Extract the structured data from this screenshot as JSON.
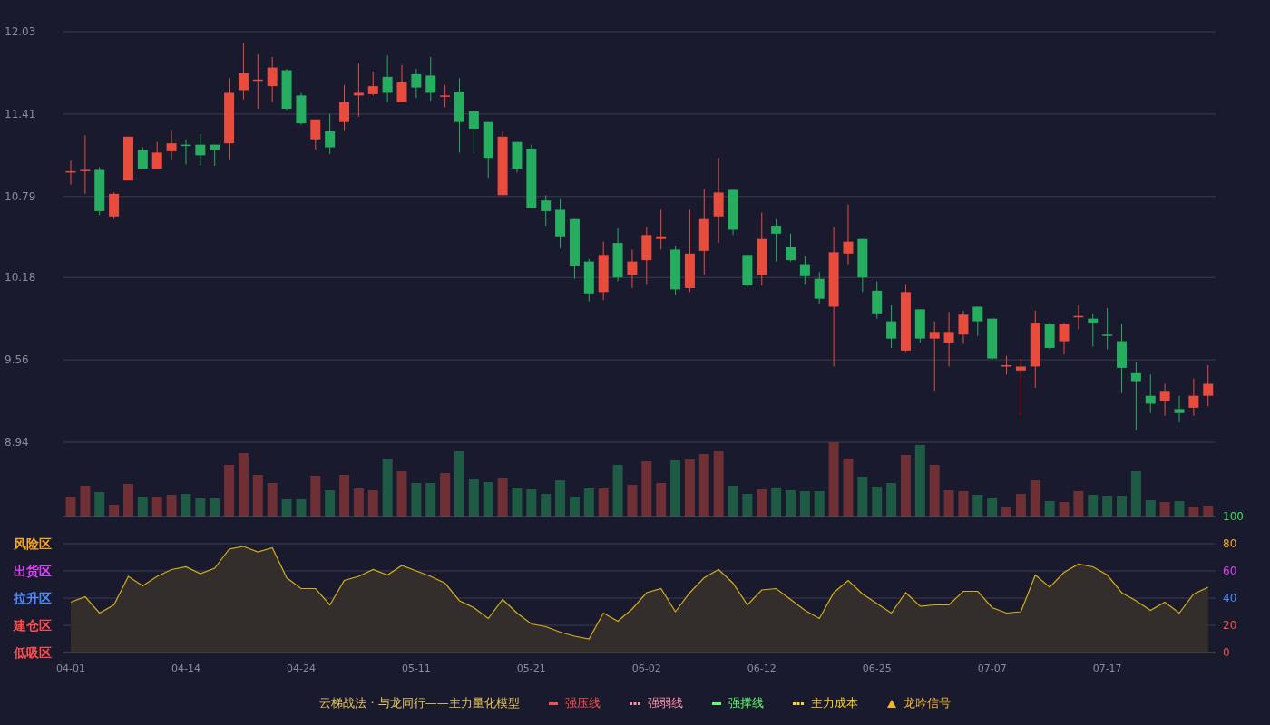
{
  "price_chart": {
    "chart_data": {
      "type": "candlestick",
      "grid": true,
      "ylim": [
        8.94,
        12.03
      ],
      "yticks": [
        {
          "value": 12.03,
          "label": "12.03"
        },
        {
          "value": 11.41,
          "label": "11.41"
        },
        {
          "value": 10.79,
          "label": "10.79"
        },
        {
          "value": 10.18,
          "label": "10.18"
        },
        {
          "value": 9.56,
          "label": "9.56"
        },
        {
          "value": 8.94,
          "label": "8.94"
        }
      ],
      "categories": [
        null,
        null,
        null,
        null,
        null,
        null,
        null,
        null,
        null,
        null,
        null,
        null,
        null,
        null,
        null,
        null,
        null,
        null,
        null,
        null,
        null,
        null,
        null,
        null,
        null,
        null,
        null,
        null,
        null,
        null,
        null,
        null,
        null,
        null,
        null,
        null,
        null,
        null,
        null,
        null,
        null,
        null,
        null,
        null,
        null,
        null,
        null,
        null,
        null,
        null,
        null,
        null,
        null,
        null,
        null,
        null,
        null,
        null,
        null,
        null,
        null,
        null,
        null,
        null,
        null,
        null,
        null,
        null,
        null,
        null,
        null,
        null,
        null,
        null,
        null,
        null,
        null,
        null,
        null,
        null
      ],
      "ohlc": [
        [
          10.97,
          11.06,
          10.88,
          10.98
        ],
        [
          10.98,
          11.25,
          10.81,
          10.99
        ],
        [
          10.99,
          11.01,
          10.65,
          10.68
        ],
        [
          10.64,
          10.82,
          10.62,
          10.81
        ],
        [
          10.91,
          11.24,
          10.91,
          11.24
        ],
        [
          11.14,
          11.16,
          11.0,
          11.0
        ],
        [
          11.0,
          11.2,
          11.0,
          11.12
        ],
        [
          11.13,
          11.29,
          11.07,
          11.19
        ],
        [
          11.18,
          11.22,
          11.03,
          11.17
        ],
        [
          11.18,
          11.26,
          11.02,
          11.1
        ],
        [
          11.18,
          11.18,
          11.02,
          11.14
        ],
        [
          11.19,
          11.68,
          11.07,
          11.57
        ],
        [
          11.59,
          11.94,
          11.52,
          11.72
        ],
        [
          11.66,
          11.86,
          11.45,
          11.67
        ],
        [
          11.62,
          11.84,
          11.5,
          11.76
        ],
        [
          11.74,
          11.75,
          11.44,
          11.45
        ],
        [
          11.55,
          11.57,
          11.33,
          11.34
        ],
        [
          11.22,
          11.37,
          11.14,
          11.37
        ],
        [
          11.28,
          11.41,
          11.11,
          11.16
        ],
        [
          11.35,
          11.63,
          11.29,
          11.5
        ],
        [
          11.55,
          11.79,
          11.39,
          11.57
        ],
        [
          11.56,
          11.73,
          11.55,
          11.62
        ],
        [
          11.69,
          11.85,
          11.5,
          11.57
        ],
        [
          11.5,
          11.78,
          11.5,
          11.65
        ],
        [
          11.71,
          11.75,
          11.53,
          11.61
        ],
        [
          11.7,
          11.84,
          11.51,
          11.57
        ],
        [
          11.54,
          11.63,
          11.46,
          11.55
        ],
        [
          11.58,
          11.68,
          11.12,
          11.35
        ],
        [
          11.43,
          11.44,
          11.12,
          11.3
        ],
        [
          11.35,
          11.35,
          10.93,
          11.08
        ],
        [
          10.8,
          11.28,
          10.8,
          11.24
        ],
        [
          11.2,
          11.2,
          10.97,
          11.0
        ],
        [
          11.15,
          11.18,
          10.7,
          10.7
        ],
        [
          10.76,
          10.8,
          10.57,
          10.68
        ],
        [
          10.69,
          10.77,
          10.4,
          10.49
        ],
        [
          10.62,
          10.62,
          10.17,
          10.27
        ],
        [
          10.3,
          10.32,
          10.0,
          10.06
        ],
        [
          10.07,
          10.45,
          10.01,
          10.35
        ],
        [
          10.44,
          10.55,
          10.15,
          10.18
        ],
        [
          10.2,
          10.39,
          10.1,
          10.3
        ],
        [
          10.31,
          10.56,
          10.13,
          10.5
        ],
        [
          10.47,
          10.69,
          10.39,
          10.49
        ],
        [
          10.39,
          10.42,
          10.05,
          10.09
        ],
        [
          10.1,
          10.69,
          10.07,
          10.36
        ],
        [
          10.38,
          10.85,
          10.2,
          10.62
        ],
        [
          10.64,
          11.08,
          10.44,
          10.82
        ],
        [
          10.84,
          10.84,
          10.5,
          10.54
        ],
        [
          10.35,
          10.35,
          10.11,
          10.12
        ],
        [
          10.2,
          10.67,
          10.12,
          10.47
        ],
        [
          10.57,
          10.62,
          10.3,
          10.51
        ],
        [
          10.41,
          10.51,
          10.3,
          10.31
        ],
        [
          10.28,
          10.34,
          10.13,
          10.19
        ],
        [
          10.17,
          10.22,
          9.98,
          10.02
        ],
        [
          9.96,
          10.56,
          9.51,
          10.37
        ],
        [
          10.36,
          10.73,
          10.28,
          10.45
        ],
        [
          10.47,
          10.47,
          10.07,
          10.18
        ],
        [
          10.08,
          10.15,
          9.87,
          9.91
        ],
        [
          9.85,
          9.97,
          9.65,
          9.72
        ],
        [
          9.63,
          10.13,
          9.62,
          10.07
        ],
        [
          9.94,
          9.94,
          9.69,
          9.72
        ],
        [
          9.72,
          9.85,
          9.32,
          9.77
        ],
        [
          9.69,
          9.92,
          9.51,
          9.77
        ],
        [
          9.75,
          9.93,
          9.68,
          9.9
        ],
        [
          9.96,
          9.96,
          9.74,
          9.85
        ],
        [
          9.87,
          9.87,
          9.56,
          9.57
        ],
        [
          9.51,
          9.59,
          9.45,
          9.52
        ],
        [
          9.48,
          9.57,
          9.12,
          9.51
        ],
        [
          9.51,
          9.93,
          9.35,
          9.84
        ],
        [
          9.83,
          9.84,
          9.64,
          9.65
        ],
        [
          9.7,
          9.84,
          9.6,
          9.83
        ],
        [
          9.88,
          9.97,
          9.79,
          9.89
        ],
        [
          9.87,
          9.91,
          9.66,
          9.84
        ],
        [
          9.75,
          9.95,
          9.64,
          9.74
        ],
        [
          9.7,
          9.83,
          9.31,
          9.5
        ],
        [
          9.46,
          9.54,
          9.03,
          9.4
        ],
        [
          9.29,
          9.45,
          9.16,
          9.23
        ],
        [
          9.25,
          9.38,
          9.14,
          9.32
        ],
        [
          9.19,
          9.29,
          9.09,
          9.16
        ],
        [
          9.2,
          9.42,
          9.14,
          9.29
        ],
        [
          9.29,
          9.52,
          9.21,
          9.38
        ]
      ]
    }
  },
  "oscillator": {
    "zones": [
      {
        "label": "风险区",
        "color": "#f5a623"
      },
      {
        "label": "出货区",
        "color": "#e040fb"
      },
      {
        "label": "拉升区",
        "color": "#4a8cff"
      },
      {
        "label": "建仓区",
        "color": "#ff4d4d"
      },
      {
        "label": "低吸区",
        "color": "#ff4d4d"
      }
    ],
    "axis_labels": [
      {
        "label": "100",
        "color": "#3ddc5a"
      },
      {
        "label": "80",
        "color": "#f5a623"
      },
      {
        "label": "60",
        "color": "#e040fb"
      },
      {
        "label": "40",
        "color": "#4a8cff"
      },
      {
        "label": "20",
        "color": "#ff4d4d"
      },
      {
        "label": "0",
        "color": "#ff4d4d"
      }
    ],
    "chart_data": {
      "type": "area",
      "grid": true,
      "ylim": [
        0,
        100
      ],
      "yticks": [
        100,
        80,
        60,
        40,
        20,
        0
      ],
      "categories": [
        "04-01",
        null,
        null,
        null,
        null,
        null,
        null,
        null,
        "04-14",
        null,
        null,
        null,
        null,
        null,
        null,
        null,
        "04-24",
        null,
        null,
        null,
        null,
        null,
        null,
        null,
        "05-11",
        null,
        null,
        null,
        null,
        null,
        null,
        null,
        "05-21",
        null,
        null,
        null,
        null,
        null,
        null,
        null,
        "06-02",
        null,
        null,
        null,
        null,
        null,
        null,
        null,
        "06-12",
        null,
        null,
        null,
        null,
        null,
        null,
        null,
        "06-25",
        null,
        null,
        null,
        null,
        null,
        null,
        null,
        "07-07",
        null,
        null,
        null,
        null,
        null,
        null,
        null,
        "07-17",
        null,
        null,
        null,
        null,
        null,
        null,
        null
      ],
      "series": [
        {
          "color": "#d4b017",
          "values": [
            37,
            41,
            29,
            35,
            56,
            49,
            56,
            61,
            63,
            58,
            62,
            76,
            78,
            74,
            77,
            55,
            47,
            47,
            35,
            53,
            56,
            61,
            57,
            64,
            60,
            56,
            51,
            38,
            33,
            25,
            39,
            29,
            21,
            19,
            15,
            12,
            10,
            29,
            23,
            32,
            44,
            47,
            30,
            44,
            55,
            61,
            51,
            35,
            46,
            47,
            39,
            31,
            25,
            44,
            53,
            43,
            36,
            29,
            44,
            34,
            35,
            35,
            45,
            45,
            33,
            29,
            30,
            57,
            48,
            59,
            65,
            63,
            57,
            44,
            38,
            31,
            37,
            29,
            43,
            48
          ]
        }
      ]
    }
  },
  "legend": {
    "title": "云梯战法 · 与龙同行——主力量化模型",
    "items": [
      {
        "kind": "solid",
        "label": "强压线",
        "color": "#ff4d4d"
      },
      {
        "kind": "dashed",
        "label": "强弱线",
        "color": "#ff8fa8"
      },
      {
        "kind": "solid",
        "label": "强撑线",
        "color": "#5cff6a"
      },
      {
        "kind": "dashed",
        "label": "主力成本",
        "color": "#ffd21f"
      },
      {
        "kind": "triangle",
        "label": "龙吟信号",
        "color": "#f5b533"
      }
    ]
  }
}
